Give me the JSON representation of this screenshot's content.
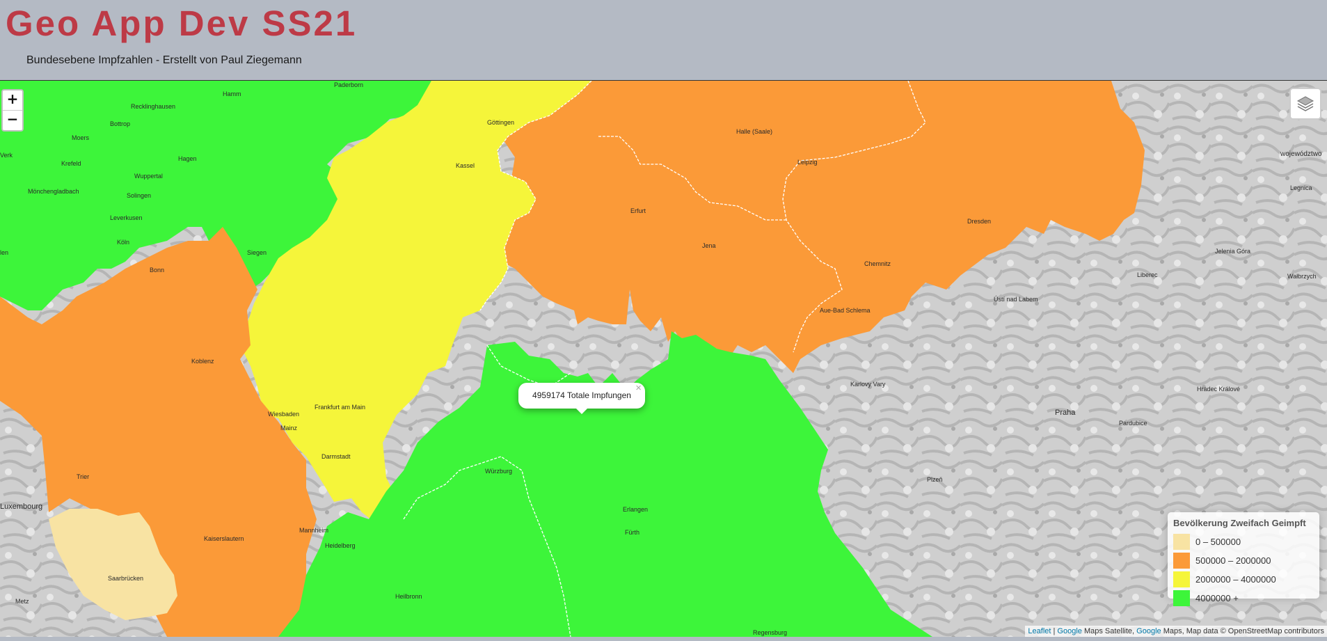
{
  "header": {
    "title": "Geo App Dev SS21",
    "subtitle": "Bundesebene Impfzahlen - Erstellt von Paul Ziegemann"
  },
  "map": {
    "zoom_in": "+",
    "zoom_out": "−",
    "layers_icon": "layers-icon",
    "popup": {
      "text": "4959174 Totale Impfungen",
      "close": "×"
    },
    "legend": {
      "title": "Bevölkerung Zweifach Geimpft",
      "items": [
        {
          "label": "0 – 500000",
          "color": "#f8e3a3"
        },
        {
          "label": "500000 – 2000000",
          "color": "#fb9a38"
        },
        {
          "label": "2000000 – 4000000",
          "color": "#f5f53a"
        },
        {
          "label": "4000000 +",
          "color": "#3df53a"
        }
      ]
    },
    "attribution": {
      "leaflet": "Leaflet",
      "sep": " | ",
      "google1": "Google",
      "mid": " Maps Satellite, ",
      "google2": "Google",
      "tail": " Maps, Map data © OpenStreetMap contributors"
    },
    "places": {
      "hamm": "Hamm",
      "paderborn": "Paderborn",
      "recklinghausen": "Recklinghausen",
      "bottrop": "Bottrop",
      "moers": "Moers",
      "krefeld": "Krefeld",
      "hagen": "Hagen",
      "wuppertal": "Wuppertal",
      "moenchengladbach": "Mönchengladbach",
      "solingen": "Solingen",
      "leverkusen": "Leverkusen",
      "koeln": "Köln",
      "bonn": "Bonn",
      "siegen": "Siegen",
      "goettingen": "Göttingen",
      "kassel": "Kassel",
      "halle": "Halle (Saale)",
      "leipzig": "Leipzig",
      "erfurt": "Erfurt",
      "jena": "Jena",
      "dresden": "Dresden",
      "chemnitz": "Chemnitz",
      "aue": "Aue-Bad Schlema",
      "koblenz": "Koblenz",
      "wiesbaden": "Wiesbaden",
      "frankfurt": "Frankfurt am Main",
      "darmstadt": "Darmstadt",
      "mainz": "Mainz",
      "trier": "Trier",
      "wuerzburg": "Würzburg",
      "mannheim": "Mannheim",
      "heidelberg": "Heidelberg",
      "kaiserslautern": "Kaiserslautern",
      "saarbruecken": "Saarbrücken",
      "heilbronn": "Heilbronn",
      "erlangen": "Erlangen",
      "fuerth": "Fürth",
      "regensburg": "Regensburg",
      "metz": "Metz",
      "luxembourg": "Luxembourg",
      "verk": "Verk",
      "len": "len",
      "usti": "Ústí nad Labem",
      "liberec": "Liberec",
      "karlovy": "Karlovy Vary",
      "praha": "Praha",
      "pardubice": "Pardubice",
      "hradec": "Hradec Králové",
      "plzen": "Plzeň",
      "jelenia": "Jelenia Góra",
      "walbrzych": "Wałbrzych",
      "legnica": "Legnica",
      "wojewodztwo": "województwo"
    }
  }
}
